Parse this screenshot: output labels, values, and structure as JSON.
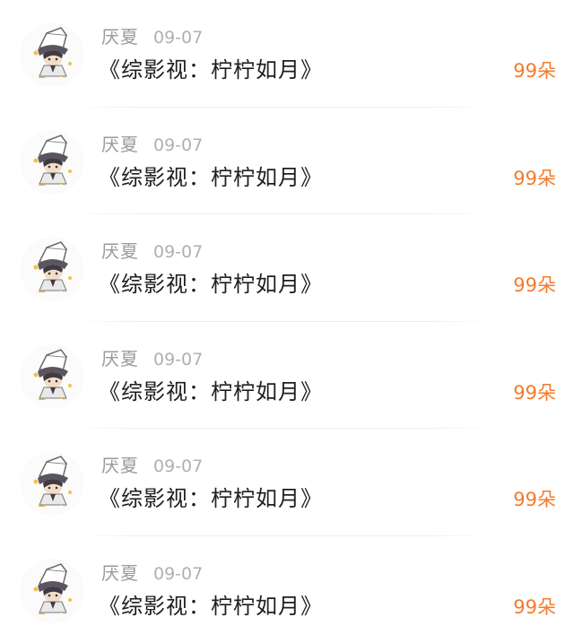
{
  "colors": {
    "name": "#9b9b9b",
    "date": "#b0b0b0",
    "title": "#1e1e1e",
    "gift": "#f47b2a",
    "divider": "#eeeeee"
  },
  "items": [
    {
      "avatar_icon": "anime-boy-avatar-icon",
      "name": "厌夏",
      "date": "09-07",
      "title": "《综影视：柠柠如月》",
      "gift": "99朵"
    },
    {
      "avatar_icon": "anime-boy-avatar-icon",
      "name": "厌夏",
      "date": "09-07",
      "title": "《综影视：柠柠如月》",
      "gift": "99朵"
    },
    {
      "avatar_icon": "anime-boy-avatar-icon",
      "name": "厌夏",
      "date": "09-07",
      "title": "《综影视：柠柠如月》",
      "gift": "99朵"
    },
    {
      "avatar_icon": "anime-boy-avatar-icon",
      "name": "厌夏",
      "date": "09-07",
      "title": "《综影视：柠柠如月》",
      "gift": "99朵"
    },
    {
      "avatar_icon": "anime-boy-avatar-icon",
      "name": "厌夏",
      "date": "09-07",
      "title": "《综影视：柠柠如月》",
      "gift": "99朵"
    },
    {
      "avatar_icon": "anime-boy-avatar-icon",
      "name": "厌夏",
      "date": "09-07",
      "title": "《综影视：柠柠如月》",
      "gift": "99朵"
    }
  ]
}
